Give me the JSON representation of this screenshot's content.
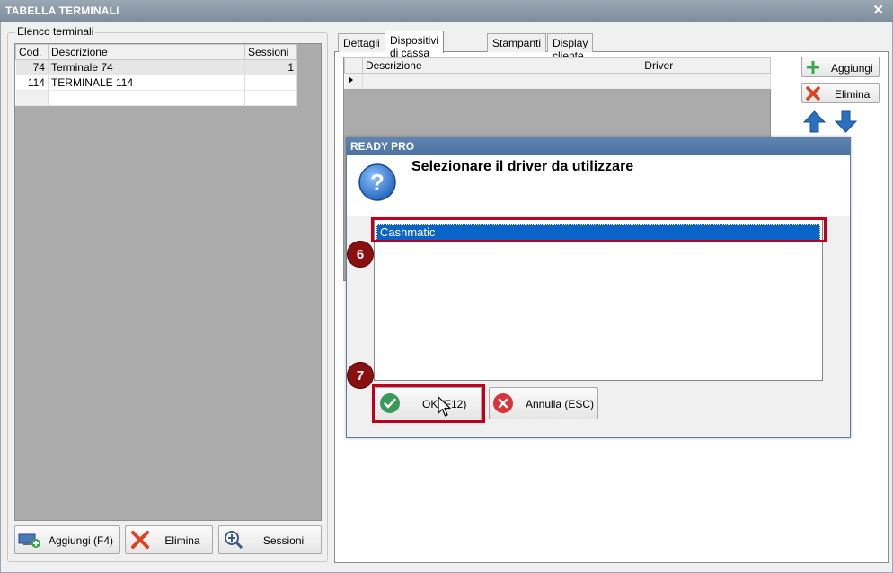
{
  "window": {
    "title": "TABELLA TERMINALI",
    "close_glyph": "✕"
  },
  "left": {
    "group_label": "Elenco terminali",
    "columns": [
      "Cod.",
      "Descrizione",
      "Sessioni"
    ],
    "rows": [
      {
        "cod": "74",
        "descrizione": "Terminale 74",
        "sessioni": "1"
      },
      {
        "cod": "114",
        "descrizione": "TERMINALE 114",
        "sessioni": ""
      }
    ],
    "buttons": {
      "add": "Aggiungi (F4)",
      "delete": "Elimina",
      "sessions": "Sessioni"
    }
  },
  "tabs": [
    "Dettagli",
    "Dispositivi di cassa",
    "Stampanti",
    "Display cliente"
  ],
  "active_tab": "Dispositivi di cassa",
  "devices": {
    "columns": [
      "Descrizione",
      "Driver"
    ],
    "buttons": {
      "add": "Aggiungi",
      "delete": "Elimina"
    }
  },
  "dialog": {
    "title": "READY PRO",
    "message": "Selezionare il driver da utilizzare",
    "items": [
      "Cashmatic"
    ],
    "ok_label": "OK (F12)",
    "cancel_label": "Annulla (ESC)"
  },
  "annotations": {
    "step6": "6",
    "step7": "7"
  },
  "colors": {
    "highlight": "#c0001a",
    "badge": "#8a0f0f",
    "selection": "#0a64c8",
    "ok_green": "#3a9a5a",
    "cancel_red": "#d9343a",
    "arrow_blue": "#2a6fc0"
  }
}
